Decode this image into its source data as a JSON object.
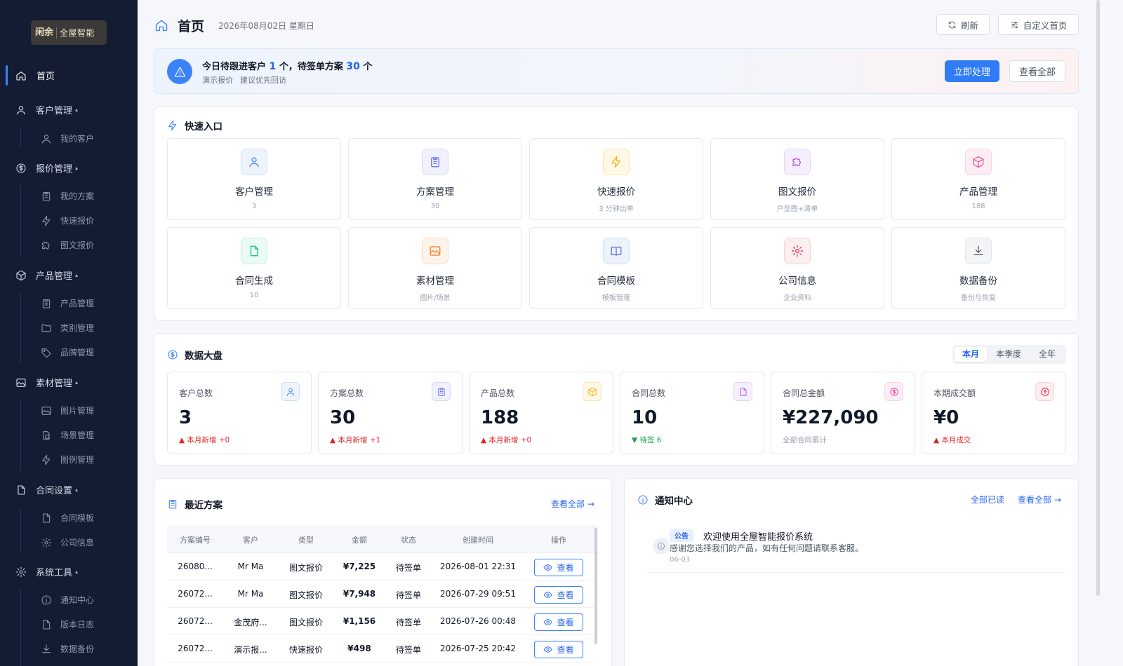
{
  "brand": {
    "mark": "闲余",
    "name": "全屋智能"
  },
  "sidebar": {
    "home": "首页",
    "groups": [
      {
        "label": "客户管理",
        "items": [
          "我的客户"
        ]
      },
      {
        "label": "报价管理",
        "items": [
          "我的方案",
          "快速报价",
          "图文报价"
        ]
      },
      {
        "label": "产品管理",
        "items": [
          "产品管理",
          "类别管理",
          "品牌管理"
        ]
      },
      {
        "label": "素材管理",
        "items": [
          "图片管理",
          "场景管理",
          "图例管理"
        ]
      },
      {
        "label": "合同设置",
        "items": [
          "合同模板",
          "公司信息"
        ]
      },
      {
        "label": "系统工具",
        "items": [
          "通知中心",
          "版本日志",
          "数据备份"
        ]
      }
    ],
    "caret": "▴"
  },
  "header": {
    "title": "首页",
    "date": "2026年08月02日 星期日",
    "refresh": "刷新",
    "customize": "自定义首页"
  },
  "alert": {
    "prefix": "今日待跟进客户",
    "follow_count": "1",
    "mid": "个，待签单方案",
    "pending_count": "30",
    "suffix": "个",
    "note1": "演示报价",
    "note2": "建议优先回访",
    "primary": "立即处理",
    "secondary": "查看全部"
  },
  "quick": {
    "title": "快速入口",
    "items": [
      {
        "label": "客户管理",
        "sub": "3"
      },
      {
        "label": "方案管理",
        "sub": "30"
      },
      {
        "label": "快速报价",
        "sub": "3 分钟出单"
      },
      {
        "label": "图文报价",
        "sub": "户型图+清单"
      },
      {
        "label": "产品管理",
        "sub": "188"
      },
      {
        "label": "合同生成",
        "sub": "10"
      },
      {
        "label": "素材管理",
        "sub": "图片/场景"
      },
      {
        "label": "合同模板",
        "sub": "模板管理"
      },
      {
        "label": "公司信息",
        "sub": "企业资料"
      },
      {
        "label": "数据备份",
        "sub": "备份与恢复"
      }
    ]
  },
  "stats": {
    "title": "数据大盘",
    "periods": [
      "本月",
      "本季度",
      "全年"
    ],
    "active_period": "本月",
    "items": [
      {
        "label": "客户总数",
        "value": "3",
        "foot": "▲ 本月新增 +0",
        "trend": "up"
      },
      {
        "label": "方案总数",
        "value": "30",
        "foot": "▲ 本月新增 +1",
        "trend": "up"
      },
      {
        "label": "产品总数",
        "value": "188",
        "foot": "▲ 本月新增 +0",
        "trend": "up"
      },
      {
        "label": "合同总数",
        "value": "10",
        "foot": "▼ 待签 6",
        "trend": "down"
      },
      {
        "label": "合同总金额",
        "value": "¥227,090",
        "foot": "全部合同累计",
        "trend": "muted"
      },
      {
        "label": "本期成交额",
        "value": "¥0",
        "foot": "▲ 本月成交",
        "trend": "up"
      }
    ]
  },
  "recent": {
    "title": "最近方案",
    "view_all": "查看全部 →",
    "columns": [
      "方案编号",
      "客户",
      "类型",
      "金额",
      "状态",
      "创建时间",
      "操作"
    ],
    "view_label": "查看",
    "rows": [
      {
        "id": "26080...",
        "customer": "Mr Ma",
        "type": "图文报价",
        "amount": "¥7,225",
        "status": "待签单",
        "time": "2026-08-01 22:31"
      },
      {
        "id": "26072...",
        "customer": "Mr Ma",
        "type": "图文报价",
        "amount": "¥7,948",
        "status": "待签单",
        "time": "2026-07-29 09:51"
      },
      {
        "id": "26072...",
        "customer": "金茂府...",
        "type": "图文报价",
        "amount": "¥1,156",
        "status": "待签单",
        "time": "2026-07-26 00:48"
      },
      {
        "id": "26072...",
        "customer": "演示报...",
        "type": "快速报价",
        "amount": "¥498",
        "status": "待签单",
        "time": "2026-07-25 20:42"
      }
    ]
  },
  "notify": {
    "title": "通知中心",
    "mark_all": "全部已读",
    "view_all": "查看全部 →",
    "items": [
      {
        "tag": "公告",
        "title": "欢迎使用全屋智能报价系统",
        "body": "感谢您选择我们的产品，如有任何问题请联系客服。",
        "date": "06-03"
      }
    ]
  },
  "colors": {
    "accent": "#2f7cf6",
    "sidebar_bg": "#141c33",
    "up": "#dc2626",
    "down": "#16a34a"
  }
}
